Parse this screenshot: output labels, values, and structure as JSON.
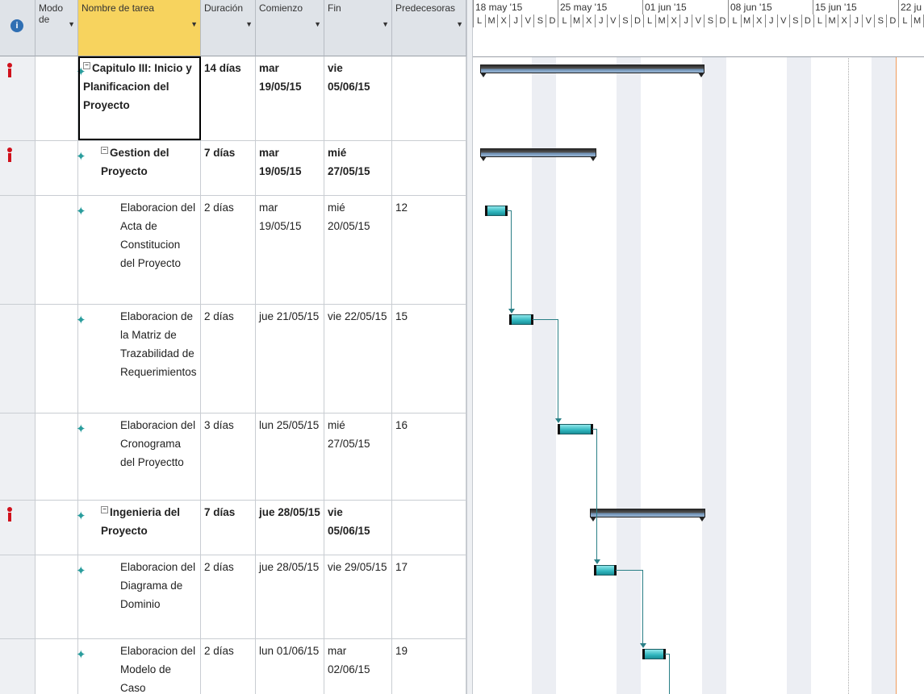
{
  "columns": {
    "info_icon": "info-icon",
    "modo": "Modo de",
    "nombre": "Nombre de tarea",
    "duracion": "Duración",
    "comienzo": "Comienzo",
    "fin": "Fin",
    "predecesoras": "Predecesoras"
  },
  "rows": [
    {
      "name": "Capitulo III: Inicio y Planificacion del Proyecto",
      "duration": "14 días",
      "start": "mar 19/05/15",
      "end": "vie 05/06/15",
      "pred": "",
      "level": 0,
      "summary": true,
      "warn": true
    },
    {
      "name": "Gestion del Proyecto",
      "duration": "7 días",
      "start": "mar 19/05/15",
      "end": "mié 27/05/15",
      "pred": "",
      "level": 1,
      "summary": true,
      "warn": true
    },
    {
      "name": "Elaboracion del Acta de Constitucion del Proyecto",
      "duration": "2 días",
      "start": "mar 19/05/15",
      "end": "mié 20/05/15",
      "pred": "12",
      "level": 2,
      "summary": false,
      "warn": false
    },
    {
      "name": "Elaboracion de la Matriz de Trazabilidad de Requerimientos",
      "duration": "2 días",
      "start": "jue 21/05/15",
      "end": "vie 22/05/15",
      "pred": "15",
      "level": 2,
      "summary": false,
      "warn": false
    },
    {
      "name": "Elaboracion del Cronograma del Proyectto",
      "duration": "3 días",
      "start": "lun 25/05/15",
      "end": "mié 27/05/15",
      "pred": "16",
      "level": 2,
      "summary": false,
      "warn": false
    },
    {
      "name": "Ingenieria del Proyecto",
      "duration": "7 días",
      "start": "jue 28/05/15",
      "end": "vie 05/06/15",
      "pred": "",
      "level": 1,
      "summary": true,
      "warn": true
    },
    {
      "name": "Elaboracion del Diagrama de Dominio",
      "duration": "2 días",
      "start": "jue 28/05/15",
      "end": "vie 29/05/15",
      "pred": "17",
      "level": 2,
      "summary": false,
      "warn": false
    },
    {
      "name": "Elaboracion del Modelo de Caso",
      "duration": "2 días",
      "start": "lun 01/06/15",
      "end": "mar 02/06/15",
      "pred": "19",
      "level": 2,
      "summary": false,
      "warn": false
    }
  ],
  "timescale": {
    "weeks": [
      "18 may '15",
      "25 may '15",
      "01 jun '15",
      "08 jun '15",
      "15 jun '15",
      "22 ju"
    ],
    "days": [
      "L",
      "M",
      "X",
      "J",
      "V",
      "S",
      "D"
    ]
  },
  "colors": {
    "header_active": "#f7d35e",
    "task_bar": "#2fb5bd",
    "summary_bar": "#333333",
    "warning": "#d0111c",
    "pin": "#2a9d9d"
  }
}
